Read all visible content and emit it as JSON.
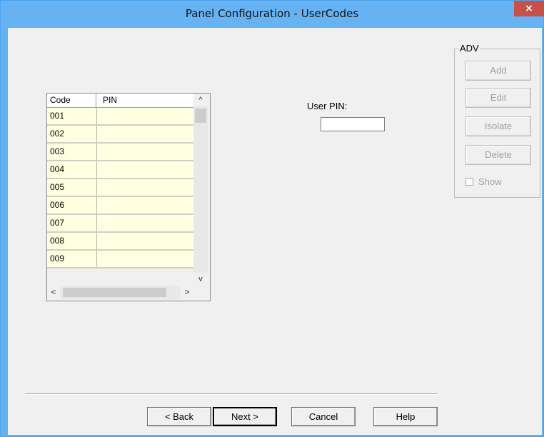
{
  "window": {
    "title": "Panel Configuration - UserCodes",
    "close_glyph": "×"
  },
  "grid": {
    "columns": [
      "Code",
      "PIN"
    ],
    "rows": [
      {
        "code": "001",
        "pin": ""
      },
      {
        "code": "002",
        "pin": ""
      },
      {
        "code": "003",
        "pin": ""
      },
      {
        "code": "004",
        "pin": ""
      },
      {
        "code": "005",
        "pin": ""
      },
      {
        "code": "006",
        "pin": ""
      },
      {
        "code": "007",
        "pin": ""
      },
      {
        "code": "008",
        "pin": ""
      },
      {
        "code": "009",
        "pin": ""
      }
    ],
    "cell_color": "#ffffe1",
    "scroll": {
      "up": "^",
      "down": "v",
      "left": "<",
      "right": ">"
    }
  },
  "user_pin": {
    "label": "User PIN:",
    "value": ""
  },
  "adv": {
    "legend": "ADV",
    "add_label": "Add",
    "edit_label": "Edit",
    "isolate_label": "Isolate",
    "delete_label": "Delete",
    "show_label": "Show",
    "show_checked": false,
    "disabled_color": "#a0a0a0"
  },
  "footer": {
    "back_label": "< Back",
    "next_label": "Next >",
    "cancel_label": "Cancel",
    "help_label": "Help"
  },
  "colors": {
    "titlebar": "#66b2f3",
    "close": "#c7504a",
    "client": "#f0f0f0"
  }
}
